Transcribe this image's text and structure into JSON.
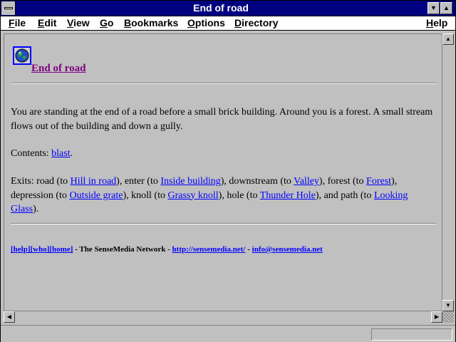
{
  "window": {
    "title": "End of road"
  },
  "menubar": {
    "items": [
      {
        "label": "File",
        "underline": "F",
        "rest": "ile"
      },
      {
        "label": "Edit",
        "underline": "E",
        "rest": "dit"
      },
      {
        "label": "View",
        "underline": "V",
        "rest": "iew"
      },
      {
        "label": "Go",
        "underline": "G",
        "rest": "o"
      },
      {
        "label": "Bookmarks",
        "underline": "B",
        "rest": "ookmarks"
      },
      {
        "label": "Options",
        "underline": "O",
        "rest": "ptions"
      },
      {
        "label": "Directory",
        "underline": "D",
        "rest": "irectory"
      },
      {
        "label": "Help",
        "underline": "H",
        "rest": "elp"
      }
    ]
  },
  "page": {
    "icon": "globe-icon",
    "heading": "End of road",
    "description": "You are standing at the end of a road before a small brick building. Around you is a forest. A small stream flows out of the building and down a gully.",
    "contents_label": "Contents: ",
    "contents_link": "blast",
    "contents_end": ".",
    "exits": [
      {
        "pre": "Exits: road (to ",
        "link": "Hill in road",
        "post": "), "
      },
      {
        "pre": "enter (to ",
        "link": "Inside building",
        "post": "), "
      },
      {
        "pre": "downstream (to ",
        "link": "Valley",
        "post": "), "
      },
      {
        "pre": "forest (to ",
        "link": "Forest",
        "post": "), "
      },
      {
        "pre": "depression (to ",
        "link": "Outside grate",
        "post": "), "
      },
      {
        "pre": "knoll (to ",
        "link": "Grassy knoll",
        "post": "), "
      },
      {
        "pre": "hole (to ",
        "link": "Thunder Hole",
        "post": "), "
      },
      {
        "pre": "and path (to ",
        "link": "Looking Glass",
        "post": ")."
      }
    ],
    "footer": {
      "help": "[help]",
      "who": "[who]",
      "home": "[home]",
      "network": " - The SenseMedia Network - ",
      "url": "http://sensemedia.net/",
      "sep": " - ",
      "email": "info@sensemedia.net"
    }
  }
}
